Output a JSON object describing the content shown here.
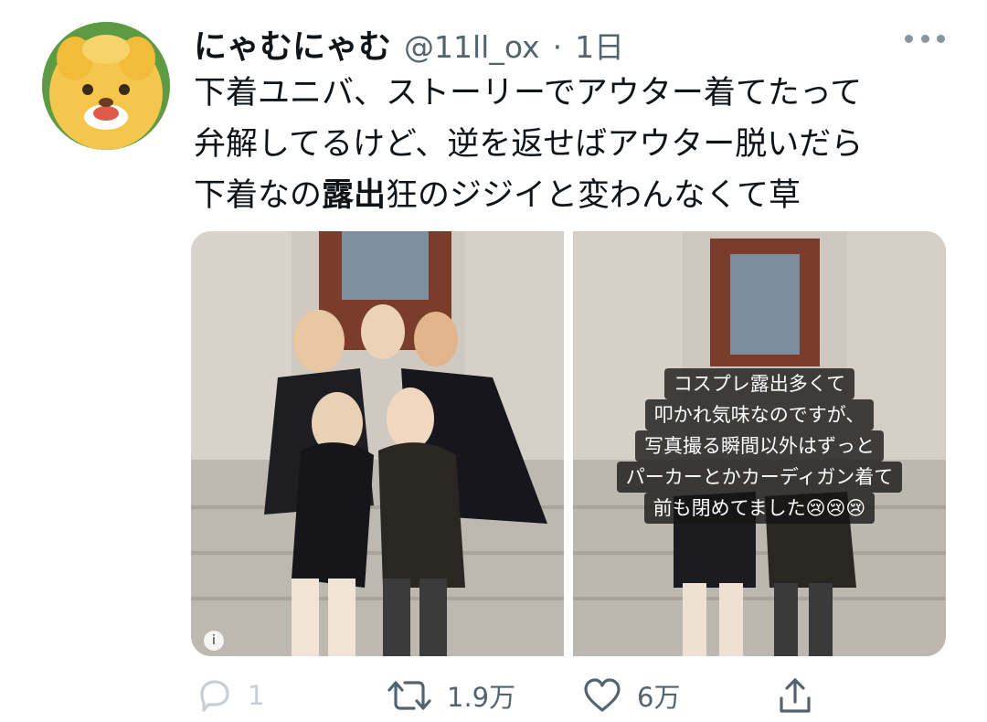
{
  "tweet": {
    "display_name": "にゃむにゃむ",
    "handle": "@11ll_ox",
    "separator": "·",
    "timestamp": "1日",
    "text_line1": "下着ユニバ、ストーリーでアウター着てたって",
    "text_line2": "弁解してるけど、逆を返せばアウター脱いだら",
    "text_line3_before": "下着なの",
    "text_line3_bold": "露出",
    "text_line3_after": "狂のジジイと変わんなくて草"
  },
  "media": {
    "story_caption": [
      "コスプレ露出多くて",
      "叩かれ気味なのですが、",
      "写真撮る瞬間以外はずっと",
      "パーカーとかカーディガン着て",
      "前も閉めてました😢😢😢"
    ]
  },
  "actions": {
    "reply_count": "1",
    "retweet_count": "1.9万",
    "like_count": "6万"
  },
  "icons": {
    "more": "more-dots-icon",
    "reply": "reply-bubble-icon",
    "retweet": "retweet-arrows-icon",
    "like": "heart-icon",
    "share": "share-upload-icon"
  },
  "colors": {
    "text_primary": "#0f1419",
    "text_secondary": "#536471",
    "reply_disabled": "#c8ced3"
  }
}
